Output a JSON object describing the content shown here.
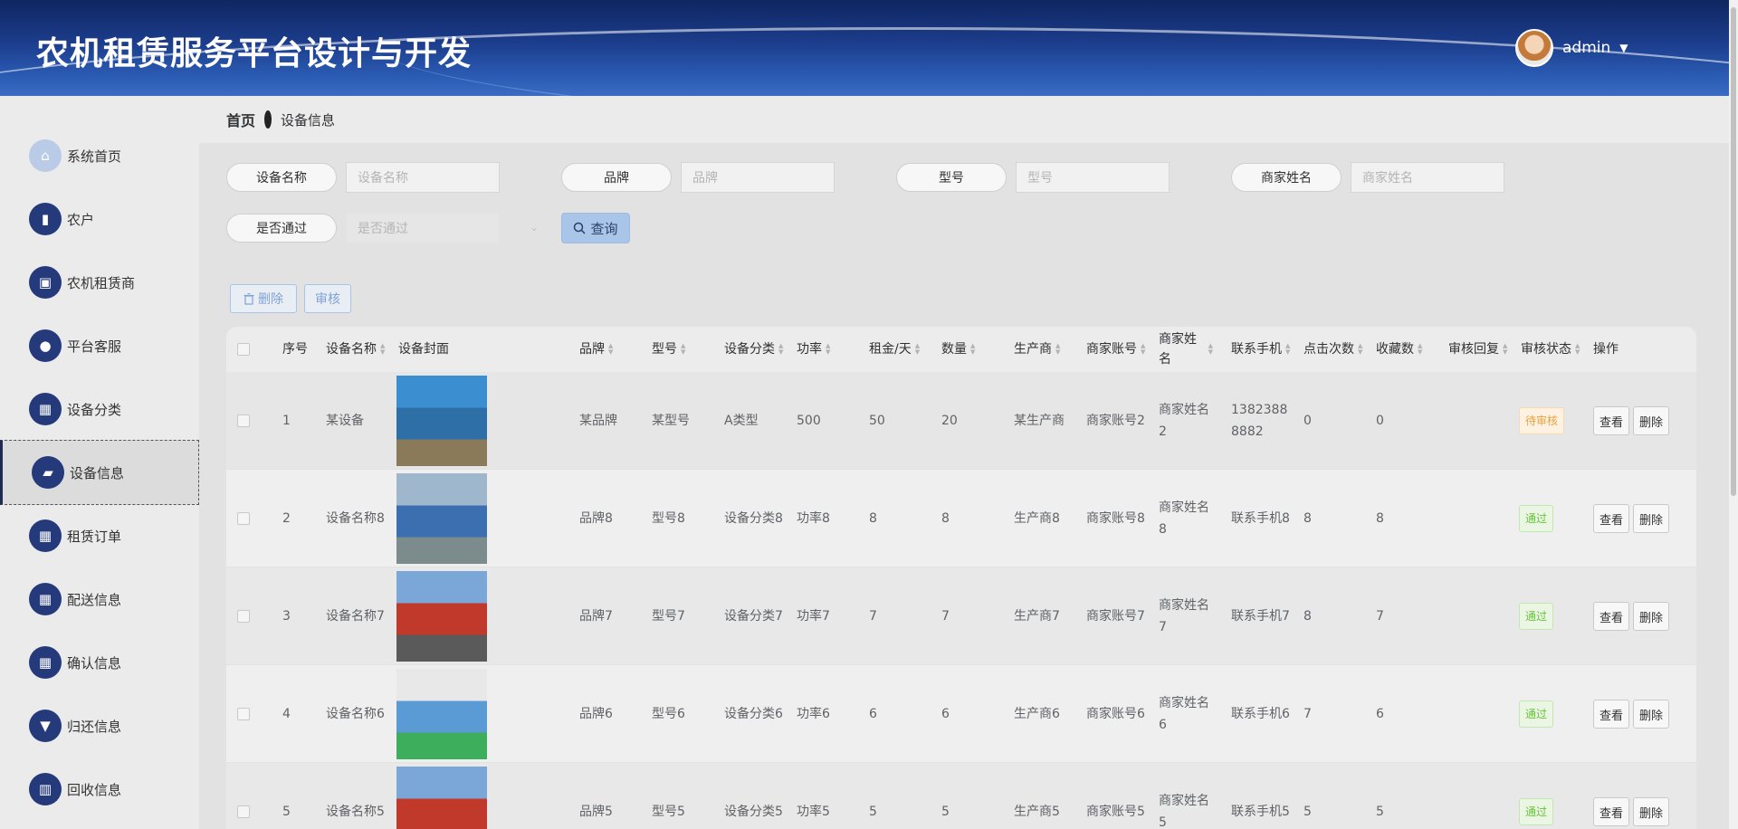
{
  "header": {
    "title": "农机租赁服务平台设计与开发",
    "username": "admin"
  },
  "breadcrumb": {
    "home": "首页",
    "current": "设备信息"
  },
  "sidebar": {
    "items": [
      {
        "label": "系统首页",
        "icon": "home-icon"
      },
      {
        "label": "农户",
        "icon": "book-icon"
      },
      {
        "label": "农机租赁商",
        "icon": "clipboard-icon"
      },
      {
        "label": "平台客服",
        "icon": "user-icon"
      },
      {
        "label": "设备分类",
        "icon": "grid-icon"
      },
      {
        "label": "设备信息",
        "icon": "briefcase-icon",
        "active": true
      },
      {
        "label": "租赁订单",
        "icon": "grid-icon"
      },
      {
        "label": "配送信息",
        "icon": "grid-icon"
      },
      {
        "label": "确认信息",
        "icon": "grid-icon"
      },
      {
        "label": "归还信息",
        "icon": "stamp-icon"
      },
      {
        "label": "回收信息",
        "icon": "chart-icon"
      }
    ]
  },
  "filters": {
    "name": {
      "label": "设备名称",
      "placeholder": "设备名称"
    },
    "brand": {
      "label": "品牌",
      "placeholder": "品牌"
    },
    "model": {
      "label": "型号",
      "placeholder": "型号"
    },
    "merchant": {
      "label": "商家姓名",
      "placeholder": "商家姓名"
    },
    "approved": {
      "label": "是否通过",
      "placeholder": "是否通过"
    },
    "query_label": "查询"
  },
  "actions": {
    "delete_label": "删除",
    "audit_label": "审核"
  },
  "table": {
    "columns": [
      "序号",
      "设备名称",
      "设备封面",
      "品牌",
      "型号",
      "设备分类",
      "功率",
      "租金/天",
      "数量",
      "生产商",
      "商家账号",
      "商家姓名",
      "联系手机",
      "点击次数",
      "收藏数",
      "审核回复",
      "审核状态",
      "操作"
    ],
    "rows": [
      {
        "no": "1",
        "name": "某设备",
        "brand": "某品牌",
        "model": "某型号",
        "category": "A类型",
        "power": "500",
        "rent": "50",
        "qty": "20",
        "maker": "某生产商",
        "account": "商家账号2",
        "merchant": "商家姓名2",
        "phone": "13823888882",
        "clicks": "0",
        "favs": "0",
        "reply": "",
        "status": "待审核",
        "status_type": "pending"
      },
      {
        "no": "2",
        "name": "设备名称8",
        "brand": "品牌8",
        "model": "型号8",
        "category": "设备分类8",
        "power": "功率8",
        "rent": "8",
        "qty": "8",
        "maker": "生产商8",
        "account": "商家账号8",
        "merchant": "商家姓名8",
        "phone": "联系手机8",
        "clicks": "8",
        "favs": "8",
        "reply": "",
        "status": "通过",
        "status_type": "pass"
      },
      {
        "no": "3",
        "name": "设备名称7",
        "brand": "品牌7",
        "model": "型号7",
        "category": "设备分类7",
        "power": "功率7",
        "rent": "7",
        "qty": "7",
        "maker": "生产商7",
        "account": "商家账号7",
        "merchant": "商家姓名7",
        "phone": "联系手机7",
        "clicks": "8",
        "favs": "7",
        "reply": "",
        "status": "通过",
        "status_type": "pass"
      },
      {
        "no": "4",
        "name": "设备名称6",
        "brand": "品牌6",
        "model": "型号6",
        "category": "设备分类6",
        "power": "功率6",
        "rent": "6",
        "qty": "6",
        "maker": "生产商6",
        "account": "商家账号6",
        "merchant": "商家姓名6",
        "phone": "联系手机6",
        "clicks": "7",
        "favs": "6",
        "reply": "",
        "status": "通过",
        "status_type": "pass"
      },
      {
        "no": "5",
        "name": "设备名称5",
        "brand": "品牌5",
        "model": "型号5",
        "category": "设备分类5",
        "power": "功率5",
        "rent": "5",
        "qty": "5",
        "maker": "生产商5",
        "account": "商家账号5",
        "merchant": "商家姓名5",
        "phone": "联系手机5",
        "clicks": "5",
        "favs": "5",
        "reply": "",
        "status": "通过",
        "status_type": "pass"
      }
    ],
    "view_label": "查看",
    "delete_label": "删除"
  }
}
